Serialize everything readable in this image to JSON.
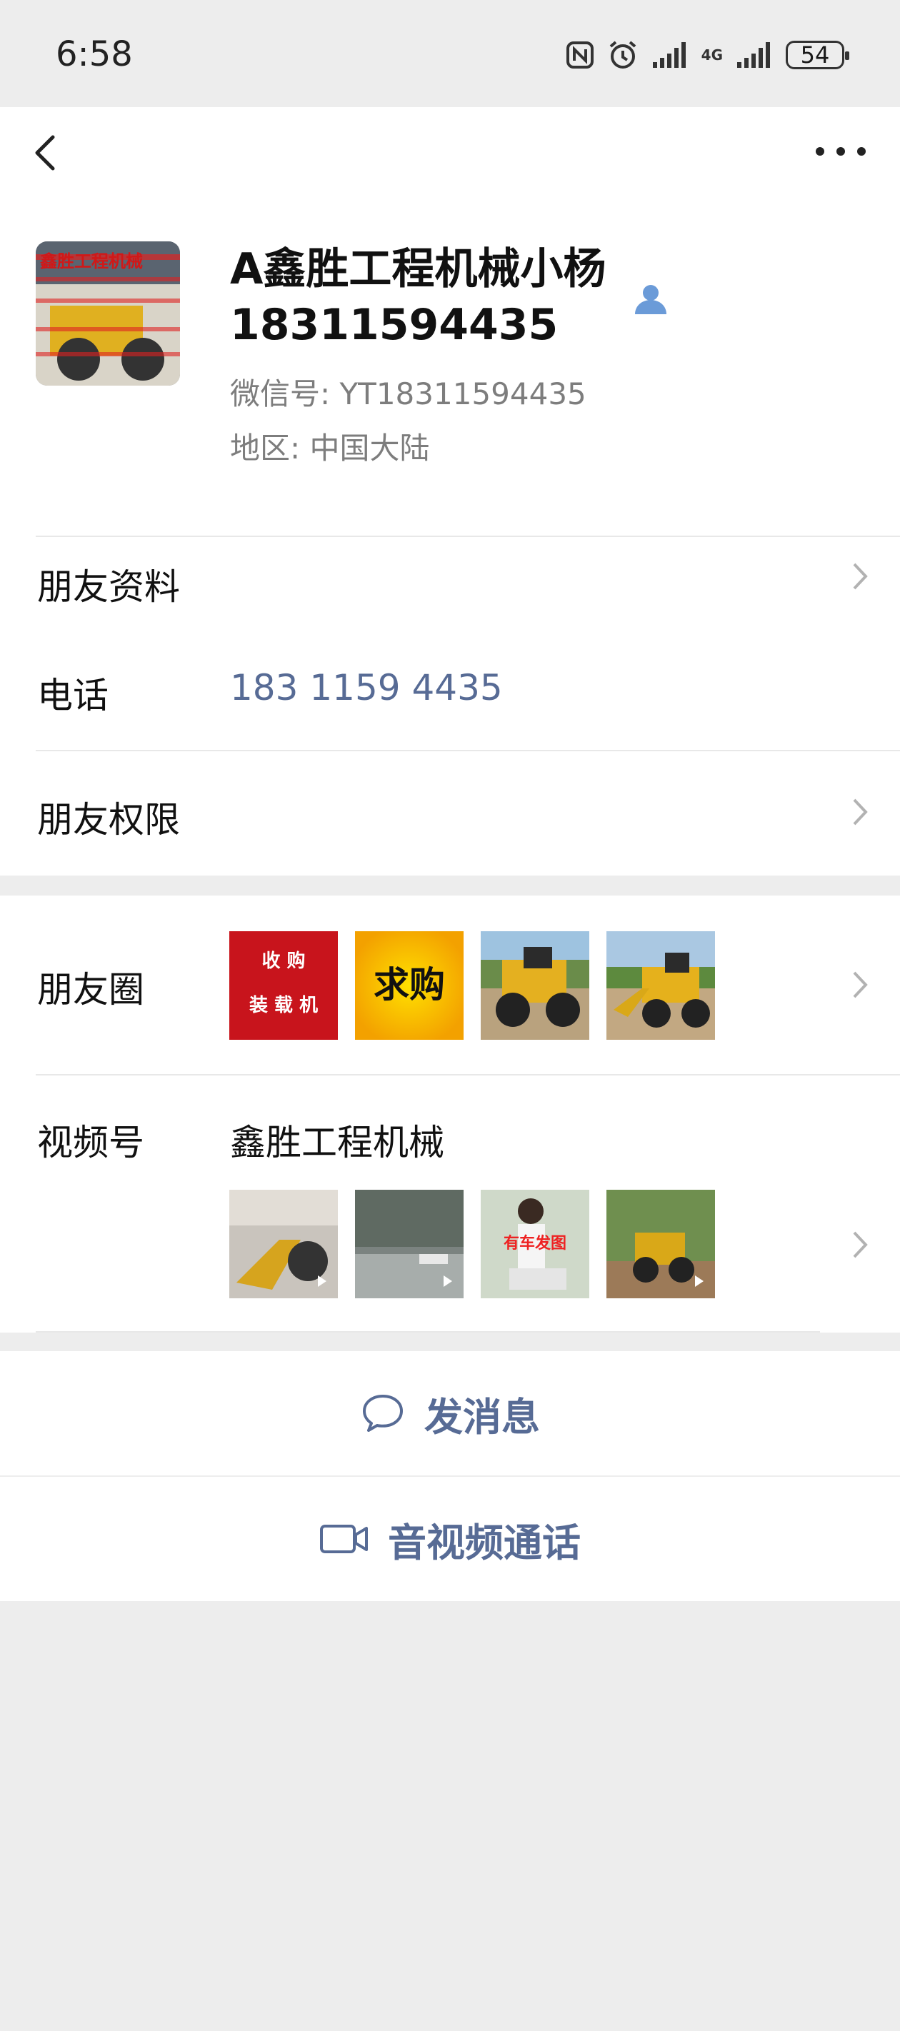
{
  "status_bar": {
    "time": "6:58",
    "network": "4G",
    "battery": "54"
  },
  "profile": {
    "name": "A鑫胜工程机械小杨18311594435",
    "wechat_id_label": "微信号: ",
    "wechat_id": "YT18311594435",
    "region_label": "地区: ",
    "region": "中国大陆",
    "avatar_caption": "鑫胜工程机械"
  },
  "rows": {
    "friend_info": "朋友资料",
    "phone_label": "电话",
    "phone_value": "183 1159 4435",
    "permissions": "朋友权限",
    "moments": "朋友圈",
    "channels": "视频号",
    "channel_name": "鑫胜工程机械"
  },
  "moments_thumbs": [
    {
      "type": "text-card",
      "line1": "收 购",
      "line2": "装 载 机",
      "bg": "#c8141c"
    },
    {
      "type": "text-card",
      "line1": "求购",
      "bg": "#f3a100"
    },
    {
      "type": "photo",
      "subject": "wheel-loader"
    },
    {
      "type": "photo",
      "subject": "wheel-loader"
    }
  ],
  "channel_thumbs": [
    {
      "subject": "loader-on-street"
    },
    {
      "subject": "rainy-street"
    },
    {
      "subject": "woman-scooter",
      "overlay": "有车发图"
    },
    {
      "subject": "loader-in-woods"
    }
  ],
  "actions": {
    "message": "发消息",
    "call": "音视频通话"
  },
  "colors": {
    "link": "#576b95",
    "background": "#ededed"
  }
}
